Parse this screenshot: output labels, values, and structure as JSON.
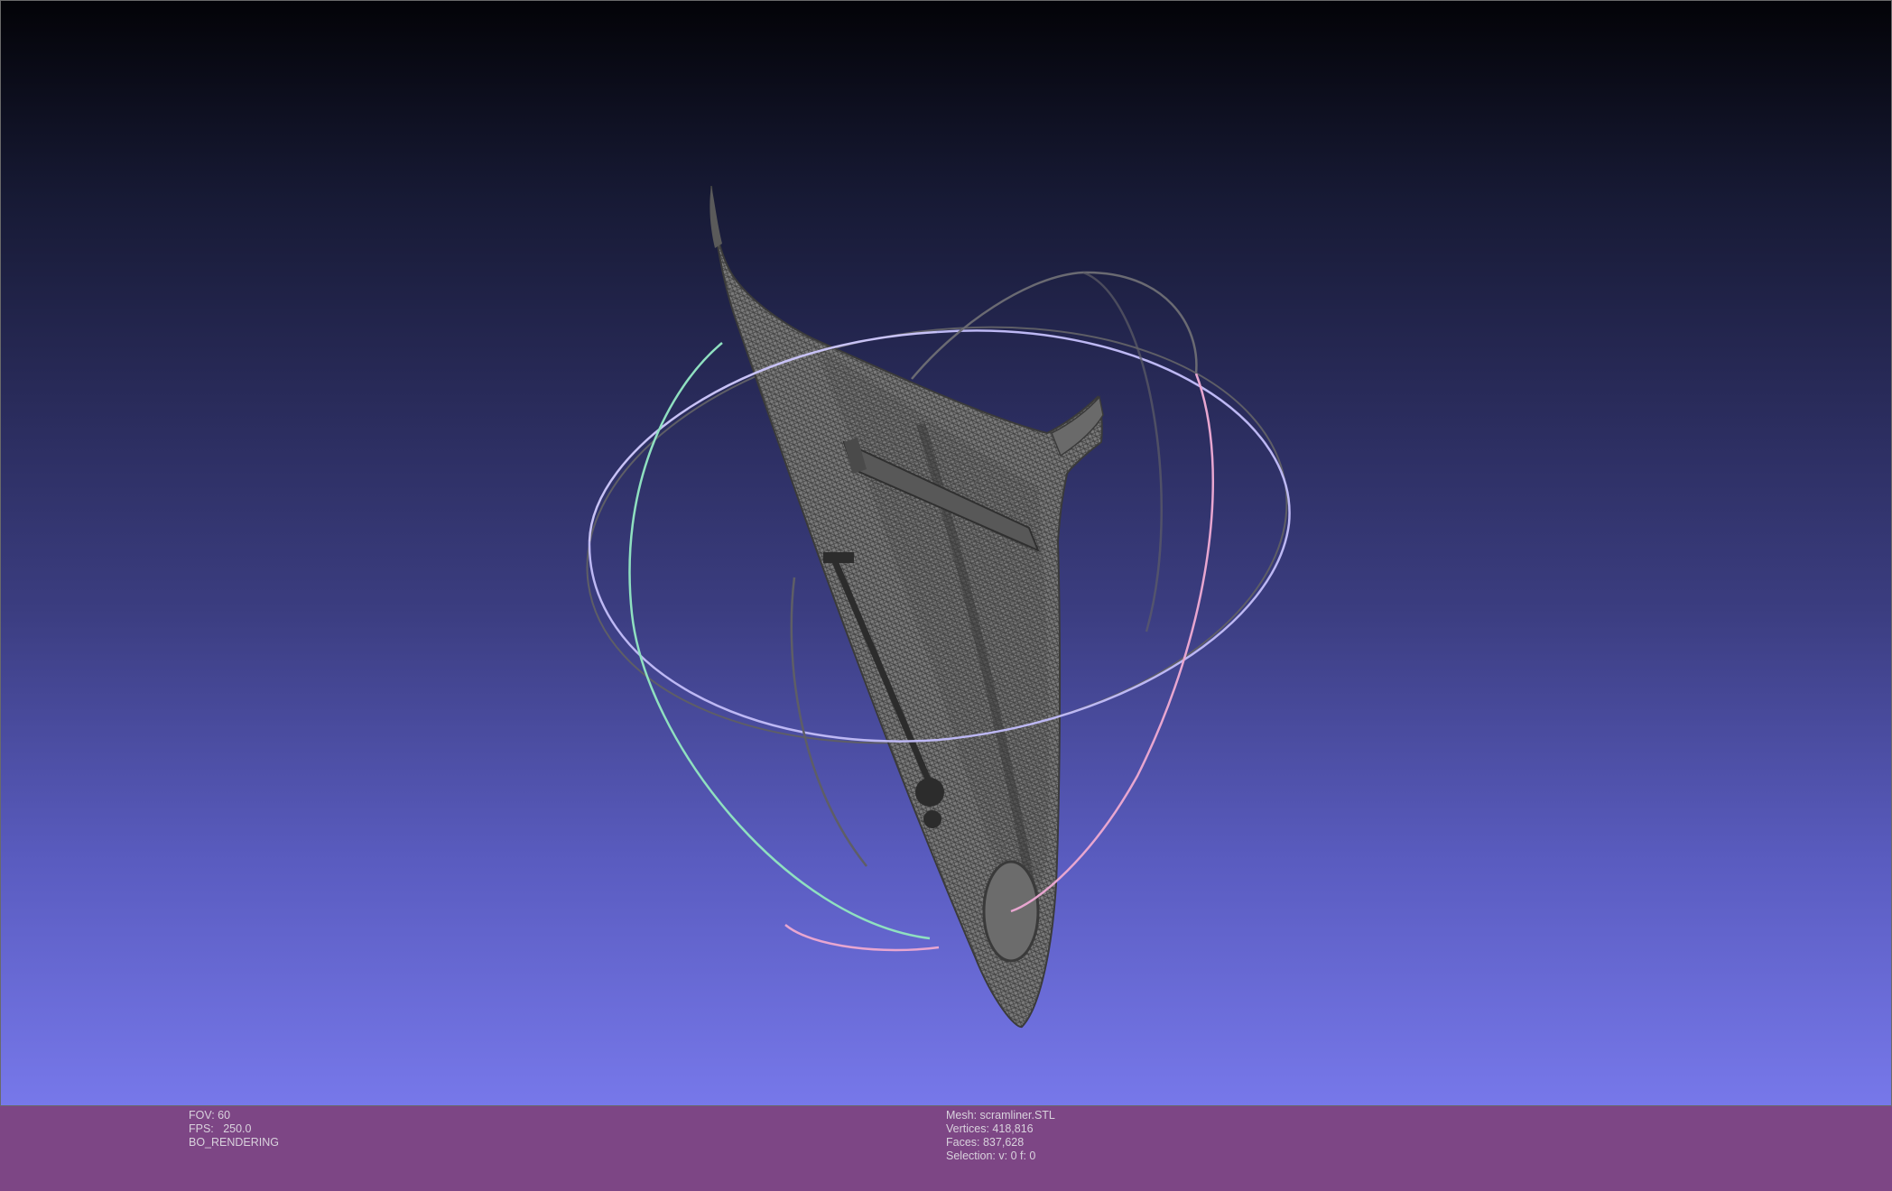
{
  "viewport": {
    "background_top": "#030307",
    "background_bottom": "#7778ea",
    "mesh_color": "#5a5a5a",
    "trackball": {
      "ring_colors": [
        "#8fe0c0",
        "#e8a6d0",
        "#bdb8f4"
      ],
      "ring_shadow_color": "#5e5e66"
    }
  },
  "info_left": {
    "fov_line": "FOV: 60",
    "fps_line": "FPS:   250.0",
    "render_mode": "BO_RENDERING"
  },
  "info_right": {
    "mesh_line": "Mesh: scramliner.STL",
    "vertices_line": "Vertices: 418,816",
    "faces_line": "Faces: 837,628",
    "selection_line": "Selection: v: 0 f: 0"
  },
  "infobar_color": "#7d4685"
}
